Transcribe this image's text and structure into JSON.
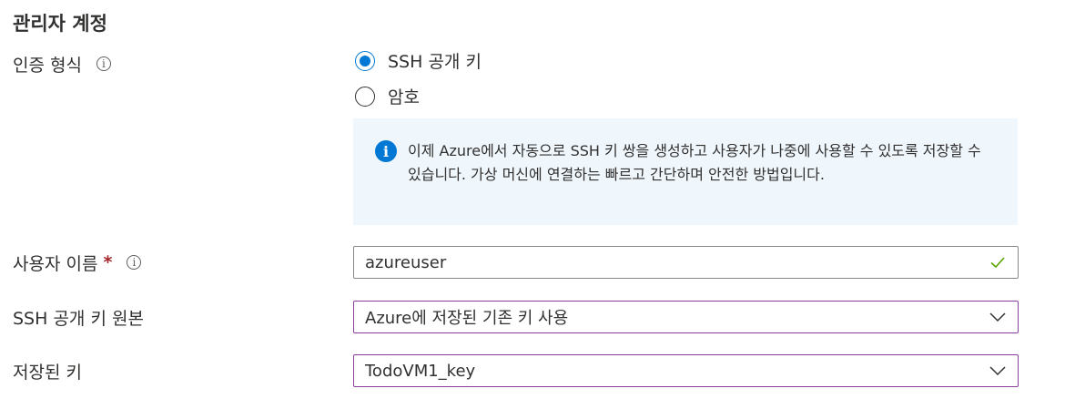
{
  "section_title": "관리자 계정",
  "auth": {
    "label": "인증 형식",
    "options": [
      {
        "label": "SSH 공개 키",
        "selected": true
      },
      {
        "label": "암호",
        "selected": false
      }
    ],
    "info_message": "이제 Azure에서 자동으로 SSH 키 쌍을 생성하고 사용자가 나중에 사용할 수 있도록 저장할 수 있습니다. 가상 머신에 연결하는 빠르고 간단하며 안전한 방법입니다."
  },
  "username": {
    "label": "사용자 이름",
    "required_mark": "*",
    "value": "azureuser"
  },
  "ssh_source": {
    "label": "SSH 공개 키 원본",
    "value": "Azure에 저장된 기존 키 사용"
  },
  "stored_key": {
    "label": "저장된 키",
    "value": "TodoVM1_key"
  },
  "colors": {
    "accent": "#0078d4",
    "info_bg": "#eff6fc",
    "valid": "#57a300",
    "required": "#a4262c",
    "dropdown_border": "#8a3f9e"
  },
  "icons": {
    "info": "info-icon",
    "info_filled": "info-filled-icon",
    "valid": "checkmark-icon",
    "dropdown": "chevron-down-icon"
  }
}
